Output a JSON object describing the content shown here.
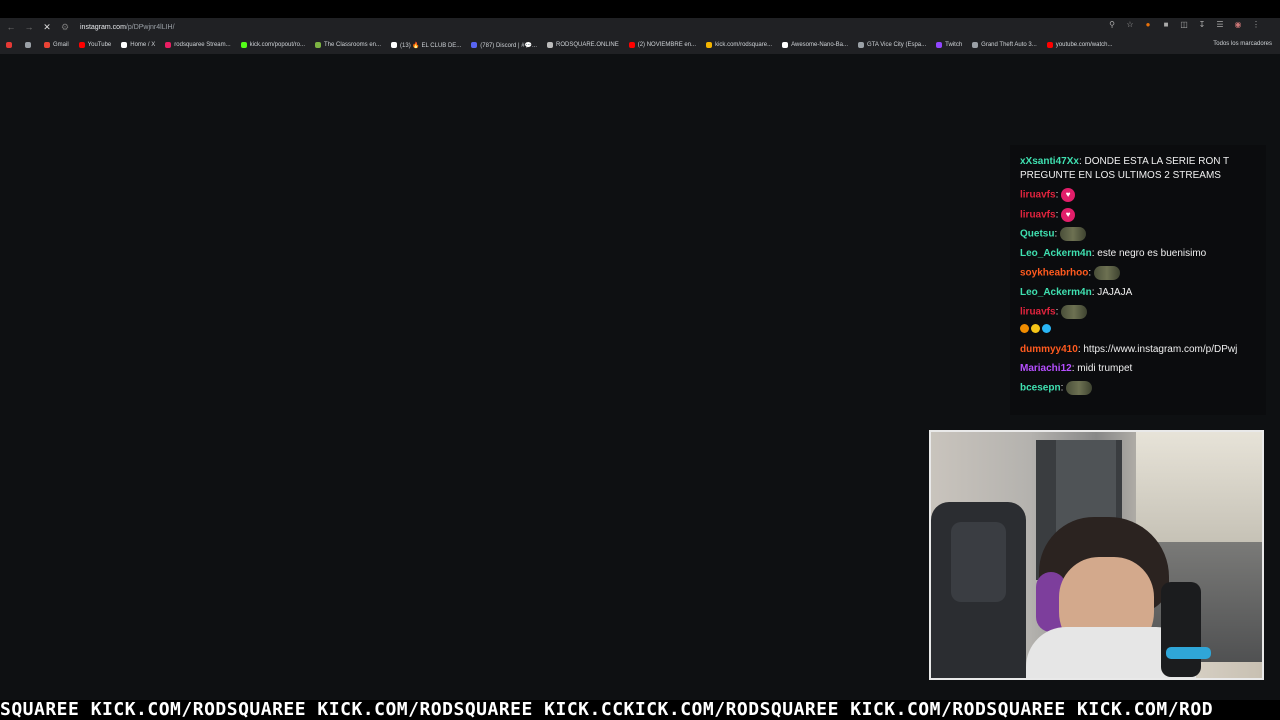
{
  "browser": {
    "url_host": "instagram.com",
    "url_path": "/p/DPwjnr4lLIH/",
    "bookmarks": [
      {
        "label": "Gmail",
        "color": "#ea4335"
      },
      {
        "label": "YouTube",
        "color": "#ff0000"
      },
      {
        "label": "Home / X",
        "color": "#ffffff"
      },
      {
        "label": "rodsquaree Stream...",
        "color": "#e91e63"
      },
      {
        "label": "kick.com/popout/ro...",
        "color": "#53fc18"
      },
      {
        "label": "The Classrooms en...",
        "color": "#7cb342"
      },
      {
        "label": "(13) 🔥 EL CLUB DE...",
        "color": "#ffffff"
      },
      {
        "label": "(787) Discord | #💬...",
        "color": "#5865f2"
      },
      {
        "label": "RODSQUARE.ONLINE",
        "color": "#bbbbbb"
      },
      {
        "label": "(2) NOVIEMBRE en...",
        "color": "#ff0000"
      },
      {
        "label": "kick.com/rodsquare...",
        "color": "#f4b400"
      },
      {
        "label": "Awesome-Nano-Ba...",
        "color": "#ffffff"
      },
      {
        "label": "GTA Vice City (Espa...",
        "color": "#9aa0a6"
      },
      {
        "label": "Twitch",
        "color": "#9146ff"
      },
      {
        "label": "Grand Theft Auto 3...",
        "color": "#9aa0a6"
      },
      {
        "label": "youtube.com/watch...",
        "color": "#ff0000"
      }
    ],
    "all_bookmarks_label": "Todos los marcadores"
  },
  "chat": {
    "messages": [
      {
        "user": "xXsanti47Xx",
        "color": "#3fe0b0",
        "text": "DONDE ESTA LA SERIE RON T PREGUNTE EN LOS ULTIMOS 2 STREAMS",
        "emote": ""
      },
      {
        "user": "liruavfs",
        "color": "#e0243e",
        "text": "",
        "emote": "heart"
      },
      {
        "user": "liruavfs",
        "color": "#e0243e",
        "text": "",
        "emote": "heart"
      },
      {
        "user": "Quetsu",
        "color": "#3fe0b0",
        "text": "",
        "emote": "blob"
      },
      {
        "user": "Leo_Ackerm4n",
        "color": "#3fe0b0",
        "text": "este negro es buenisimo",
        "emote": ""
      },
      {
        "user": "soykheabrhoo",
        "color": "#ff5a1f",
        "text": "",
        "emote": "blob"
      },
      {
        "user": "Leo_Ackerm4n",
        "color": "#3fe0b0",
        "text": "JAJAJA",
        "emote": ""
      },
      {
        "user": "liruavfs",
        "color": "#e0243e",
        "text": "",
        "emote": "blob"
      },
      {
        "user": "",
        "color": "#ffffff",
        "text": "",
        "emote": "emojis"
      },
      {
        "user": "dummyy410",
        "color": "#ff5a1f",
        "text": "https://www.instagram.com/p/DPwj",
        "emote": ""
      },
      {
        "user": "Mariachi12",
        "color": "#b64fff",
        "text": "midi trumpet",
        "emote": ""
      },
      {
        "user": "bcesepn",
        "color": "#3fe0b0",
        "text": "",
        "emote": "blob"
      }
    ]
  },
  "ticker": {
    "text": "SQUAREE KICK.COM/RODSQUAREE KICK.COM/RODSQUAREE KICK.CCKICK.COM/RODSQUAREE KICK.COM/RODSQUAREE KICK.COM/ROD"
  }
}
